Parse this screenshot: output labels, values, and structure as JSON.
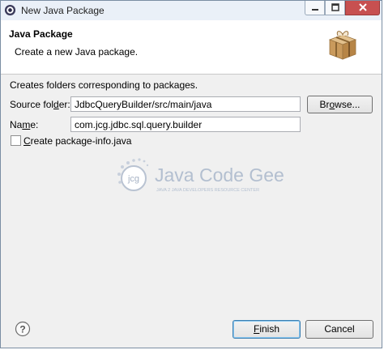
{
  "window": {
    "title": "New Java Package"
  },
  "banner": {
    "title": "Java Package",
    "description": "Create a new Java package."
  },
  "form": {
    "intro": "Creates folders corresponding to packages.",
    "source_folder": {
      "label_pre": "Source fol",
      "label_mnemonic": "d",
      "label_post": "er:",
      "value": "JdbcQueryBuilder/src/main/java",
      "browse_pre": "Br",
      "browse_mnemonic": "o",
      "browse_post": "wse..."
    },
    "name": {
      "label_pre": "Na",
      "label_mnemonic": "m",
      "label_post": "e:",
      "value": "com.jcg.jdbc.sql.query.builder"
    },
    "create_info": {
      "label_mnemonic": "C",
      "label_post": "reate package-info.java",
      "checked": false
    }
  },
  "watermark": {
    "logo_text": "jcg",
    "title": "Java Code Geeks",
    "subtitle": "JAVA 2 JAVA DEVELOPERS RESOURCE CENTER"
  },
  "footer": {
    "finish_mnemonic": "F",
    "finish_post": "inish",
    "cancel_label": "Cancel"
  },
  "icons": [
    "eclipse-app-icon",
    "minimize-icon",
    "maximize-icon",
    "close-icon",
    "package-icon",
    "help-icon"
  ]
}
